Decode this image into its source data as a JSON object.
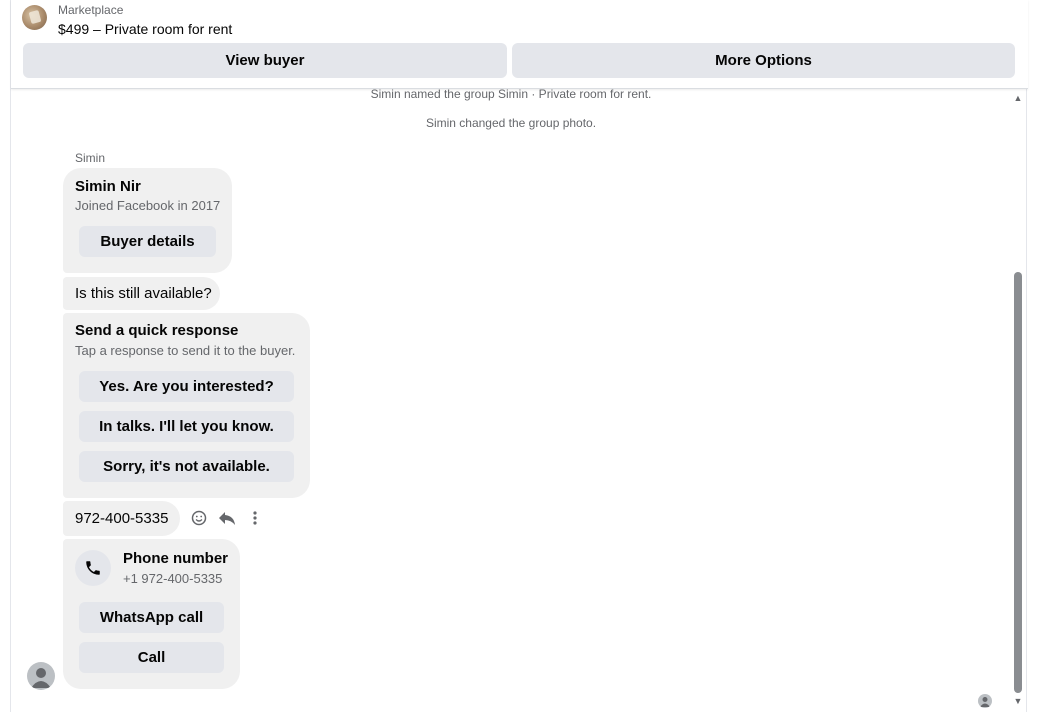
{
  "header": {
    "source_label": "Marketplace",
    "listing_title": "$499 – Private room for rent",
    "view_buyer_label": "View buyer",
    "more_options_label": "More Options"
  },
  "system_messages": [
    "Simin named the group Simin · Private room for rent.",
    "Simin changed the group photo."
  ],
  "sender_name": "Simin",
  "profile_card": {
    "name": "Simin Nir",
    "subtitle": "Joined Facebook in 2017",
    "button_label": "Buyer details"
  },
  "message_availability": "Is this still available?",
  "quick_response": {
    "title": "Send a quick response",
    "subtitle": "Tap a response to send it to the buyer.",
    "options": [
      "Yes. Are you interested?",
      "In talks. I'll let you know.",
      "Sorry, it's not available."
    ]
  },
  "message_phone": "972-400-5335",
  "message_actions": [
    "smiley-icon",
    "reply-icon",
    "more-vertical-icon"
  ],
  "phone_card": {
    "title": "Phone number",
    "number": "+1 972-400-5335",
    "whatsapp_label": "WhatsApp call",
    "call_label": "Call"
  },
  "colors": {
    "bubble": "#f0f0f0",
    "button": "#e4e6eb",
    "secondary_text": "#65676b",
    "scroll_thumb": "#8a8d91"
  }
}
